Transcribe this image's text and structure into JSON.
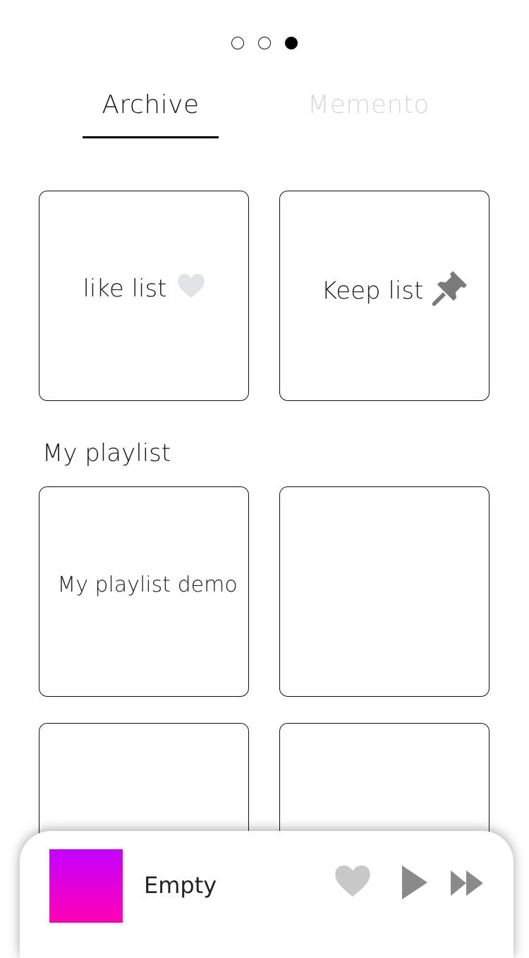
{
  "pager": {
    "count": 3,
    "active_index": 2
  },
  "tabs": [
    {
      "label": "Archive",
      "active": true
    },
    {
      "label": "Memento",
      "active": false
    }
  ],
  "archive": {
    "like_list_label": "like list",
    "keep_list_label": "Keep list"
  },
  "playlist": {
    "section_title": "My playlist",
    "items": [
      {
        "label": "My playlist demo"
      },
      {
        "label": ""
      },
      {
        "label": ""
      },
      {
        "label": ""
      }
    ]
  },
  "player": {
    "track_title": "Empty",
    "album_art_colors": [
      "#c400ff",
      "#ff00b4"
    ],
    "icons": [
      "heart-icon",
      "play-icon",
      "fast-forward-icon"
    ]
  },
  "colors": {
    "heart_light": "#e2e3e8",
    "pin_gray": "#7a7a7a",
    "player_icon_gray": "#8a8a8a",
    "player_heart_gray": "#c8c8c8",
    "tab_inactive": "#d8d8d8"
  }
}
